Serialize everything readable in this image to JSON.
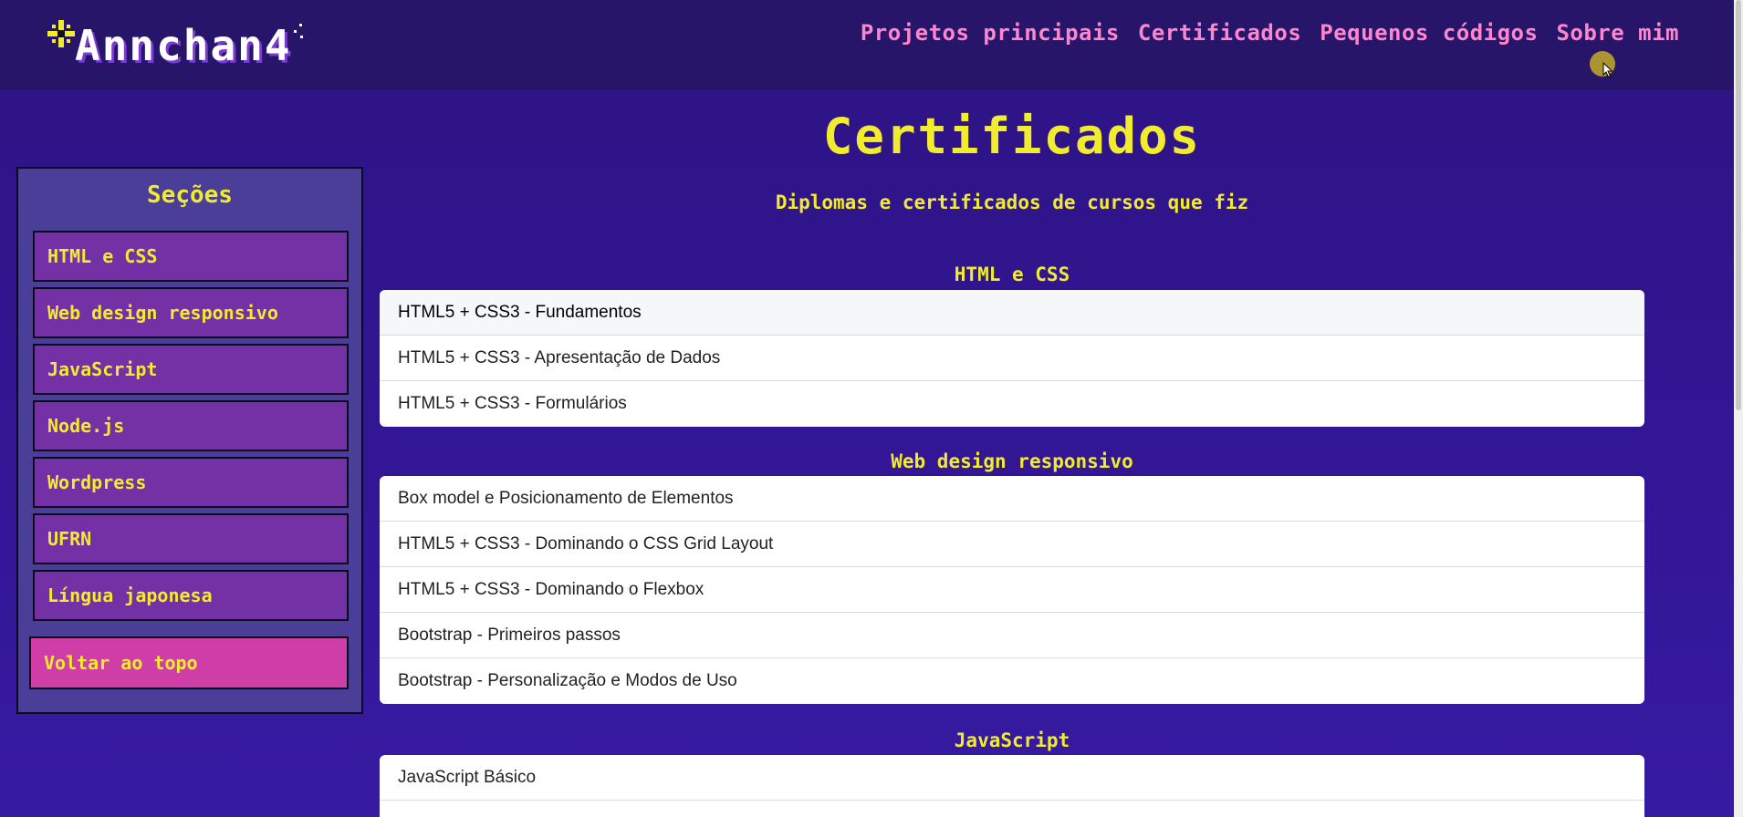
{
  "header": {
    "logo_text": "Annchan4",
    "nav": [
      "Projetos principais",
      "Certificados",
      "Pequenos códigos",
      "Sobre mim"
    ]
  },
  "sidebar": {
    "title": "Seções",
    "items": [
      {
        "label": "HTML e CSS"
      },
      {
        "label": "Web design responsivo"
      },
      {
        "label": "JavaScript"
      },
      {
        "label": "Node.js"
      },
      {
        "label": "Wordpress"
      },
      {
        "label": "UFRN"
      },
      {
        "label": "Língua japonesa"
      }
    ],
    "back_to_top": "Voltar ao topo"
  },
  "main": {
    "title": "Certificados",
    "subtitle": "Diplomas e certificados de cursos que fiz",
    "sections": [
      {
        "heading": "HTML e CSS",
        "items": [
          "HTML5 + CSS3 - Fundamentos",
          "HTML5 + CSS3 - Apresentação de Dados",
          "HTML5 + CSS3 - Formulários"
        ]
      },
      {
        "heading": "Web design responsivo",
        "items": [
          "Box model e Posicionamento de Elementos",
          "HTML5 + CSS3 - Dominando o CSS Grid Layout",
          "HTML5 + CSS3 - Dominando o Flexbox",
          "Bootstrap - Primeiros passos",
          "Bootstrap - Personalização e Modos de Uso"
        ]
      },
      {
        "heading": "JavaScript",
        "items": [
          "JavaScript Básico"
        ]
      }
    ]
  },
  "colors": {
    "background": "#321591",
    "header": "#261568",
    "accent_yellow": "#f1ec2e",
    "nav_pink": "#ff86cd",
    "sidebar_item": "#7431a5",
    "back_to_top": "#cf3ea6"
  },
  "icons": {
    "logo_star": "sparkle-star-icon",
    "cursor": "mouse-pointer-icon"
  }
}
